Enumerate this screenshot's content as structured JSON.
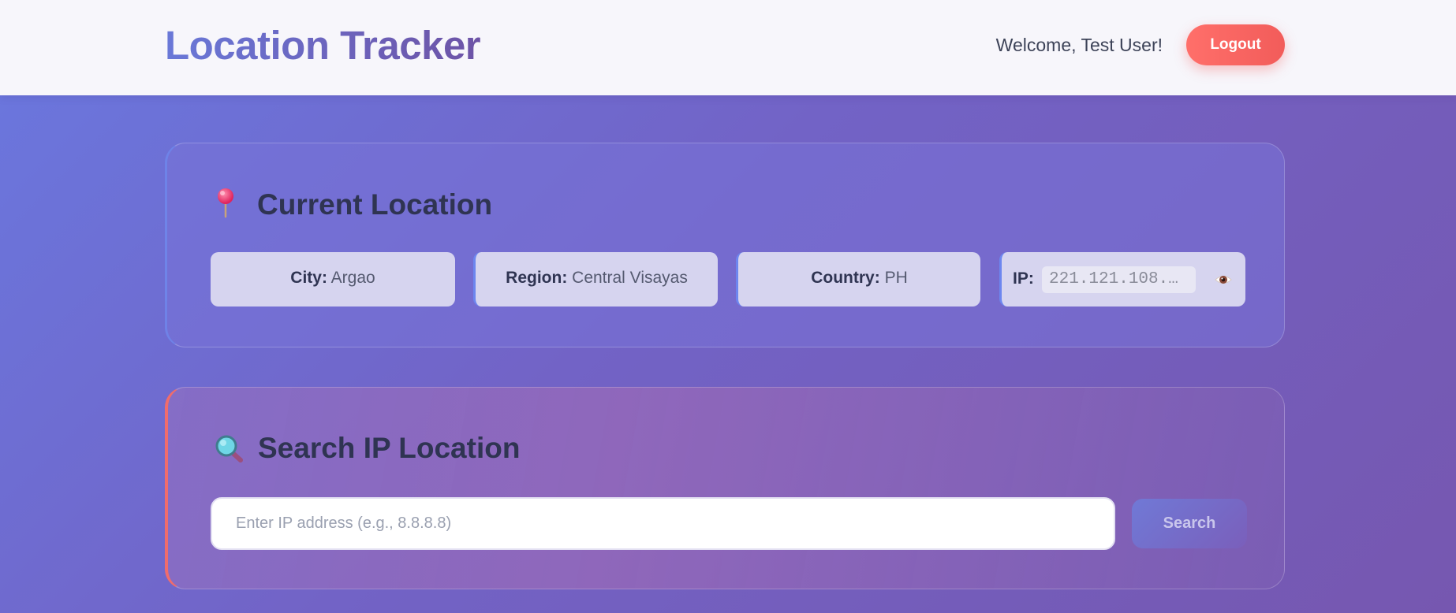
{
  "header": {
    "title": "Location Tracker",
    "welcome": "Welcome, Test User!",
    "logout_label": "Logout"
  },
  "current_location": {
    "icon": "pushpin-icon",
    "title": "Current Location",
    "city_label": "City:",
    "city": "Argao",
    "region_label": "Region:",
    "region": "Central Visayas",
    "country_label": "Country:",
    "country": "PH",
    "ip_label": "IP:",
    "ip": "221.121.108.…",
    "ip_toggle_icon": "eye-icon"
  },
  "search": {
    "icon": "magnifier-icon",
    "title": "Search IP Location",
    "placeholder": "Enter IP address (e.g., 8.8.8.8)",
    "value": "",
    "button_label": "Search"
  },
  "colors": {
    "accent_red": "#f25c5a",
    "brand_start": "#6a78d8",
    "brand_end": "#6d53a6",
    "background_start": "#6a78df",
    "background_end": "#7657b0"
  }
}
